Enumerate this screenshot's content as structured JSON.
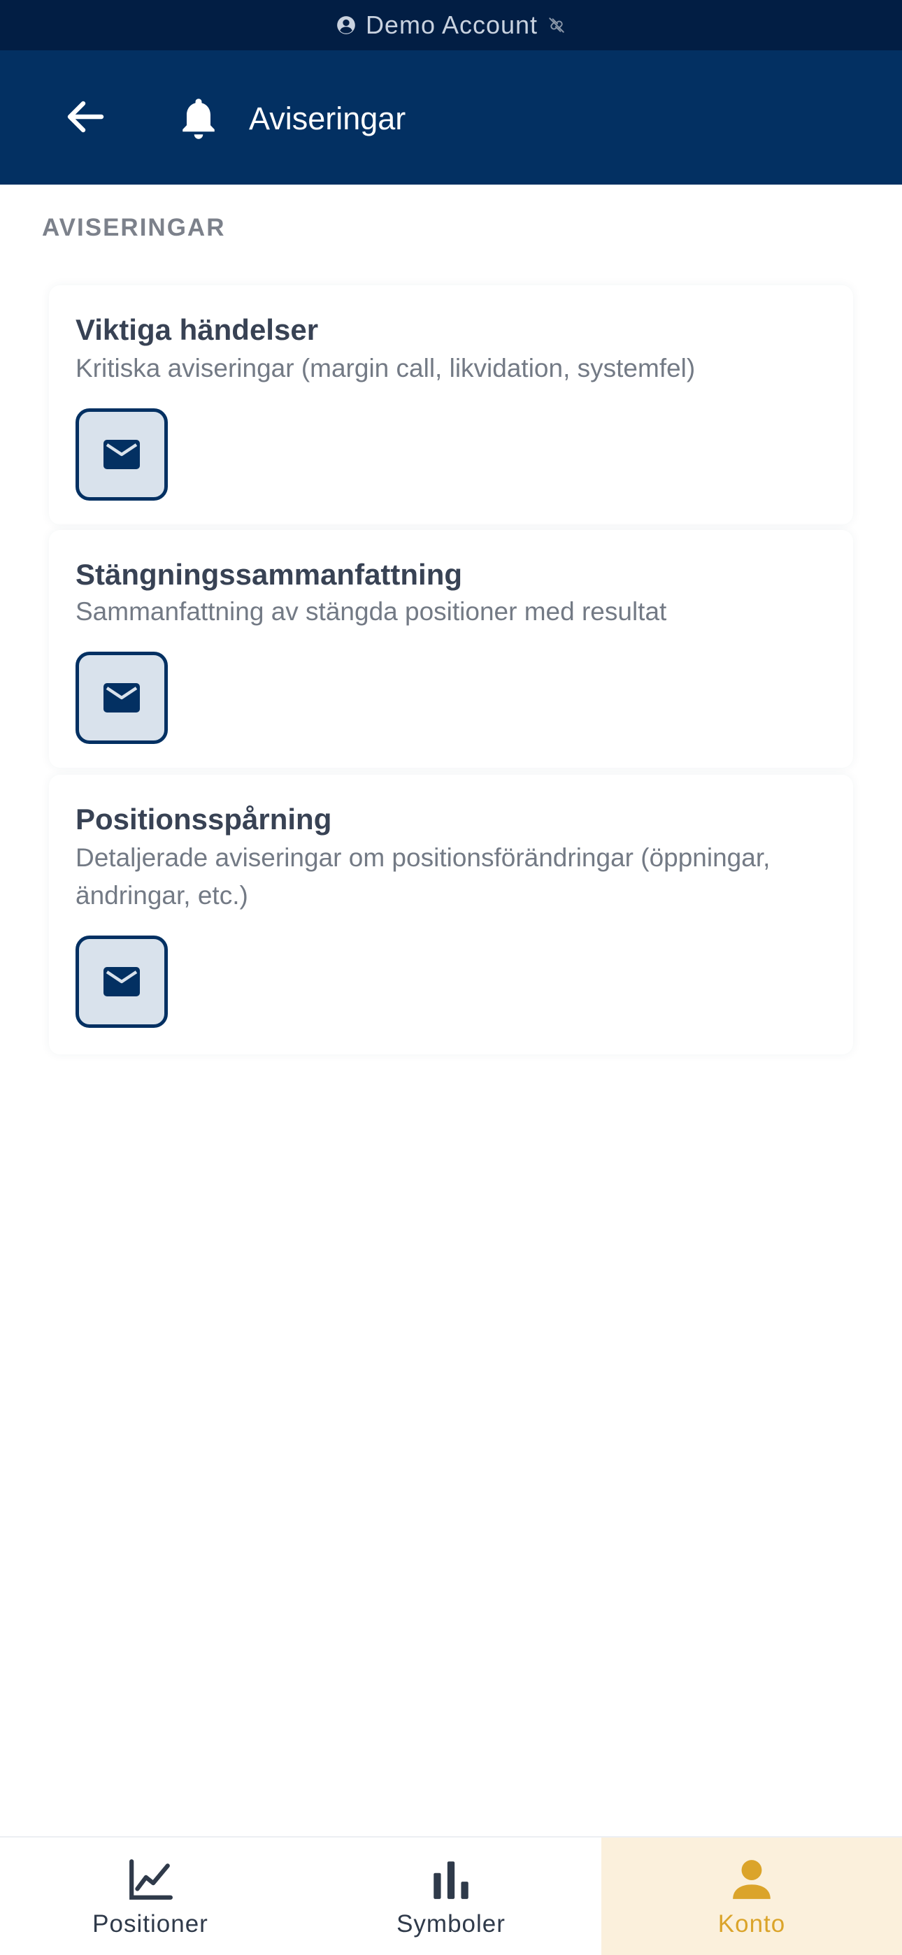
{
  "status_bar": {
    "account_label": "Demo Account",
    "account_icon": "account-circle-icon",
    "connection_icon": "link-off-icon"
  },
  "header": {
    "title": "Aviseringar",
    "back_icon": "arrow-left-icon",
    "title_icon": "bell-icon",
    "background_color": "#033062"
  },
  "section": {
    "label": "AVISERINGAR"
  },
  "notifications": [
    {
      "title": "Viktiga händelser",
      "description": "Kritiska aviseringar (margin call, likvidation, systemfel)",
      "channel_icon": "mail-icon"
    },
    {
      "title": "Stängningssammanfattning",
      "description": "Sammanfattning av stängda positioner med resultat",
      "channel_icon": "mail-icon"
    },
    {
      "title": "Positionsspårning",
      "description": "Detaljerade aviseringar om positionsförändringar (öppningar, ändringar, etc.)",
      "channel_icon": "mail-icon"
    }
  ],
  "bottom_nav": {
    "items": [
      {
        "label": "Positioner",
        "icon": "line-chart-icon",
        "active": false
      },
      {
        "label": "Symboler",
        "icon": "bar-chart-icon",
        "active": false
      },
      {
        "label": "Konto",
        "icon": "person-icon",
        "active": true
      }
    ],
    "active_color": "#dba42a"
  }
}
